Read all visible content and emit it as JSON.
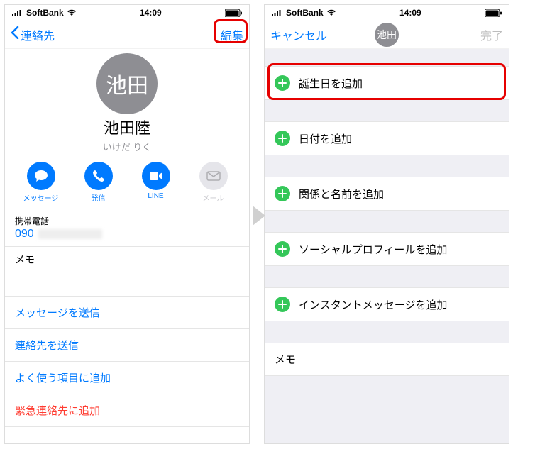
{
  "status": {
    "carrier": "SoftBank",
    "time": "14:09"
  },
  "left": {
    "back_label": "連絡先",
    "edit_label": "編集",
    "avatar_text": "池田",
    "name": "池田陸",
    "reading": "いけだ りく",
    "actions": {
      "message": "メッセージ",
      "call": "発信",
      "video": "LINE",
      "mail": "メール"
    },
    "phone_label": "携帯電話",
    "phone_value": "090",
    "memo_label": "メモ",
    "links": {
      "send_message": "メッセージを送信",
      "send_contact": "連絡先を送信",
      "favorites": "よく使う項目に追加",
      "emergency": "緊急連絡先に追加"
    }
  },
  "right": {
    "cancel_label": "キャンセル",
    "done_label": "完了",
    "avatar_text": "池田",
    "rows": {
      "birthday": "誕生日を追加",
      "date": "日付を追加",
      "relation": "関係と名前を追加",
      "social": "ソーシャルプロフィールを追加",
      "im": "インスタントメッセージを追加"
    },
    "memo_label": "メモ"
  }
}
